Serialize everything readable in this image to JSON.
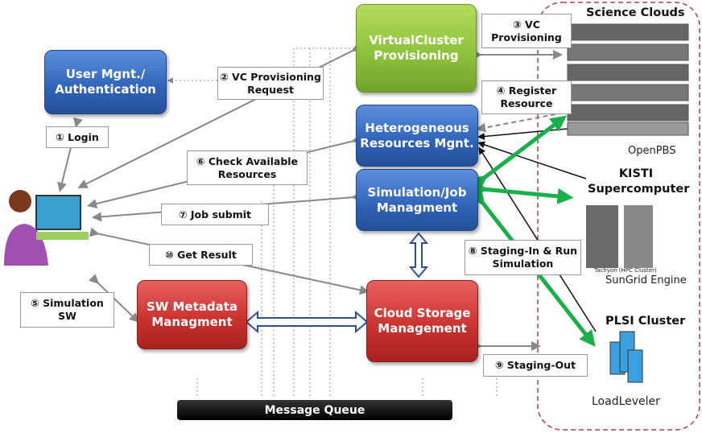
{
  "boxes": {
    "user_mgnt": "User Mgnt./ Authentication",
    "virtual_cluster": "VirtualCluster Provisioning",
    "heterogeneous": "Heterogeneous Resources Mgnt.",
    "simulation_job": "Simulation/Job Managment",
    "sw_metadata": "SW Metadata Managment",
    "cloud_storage": "Cloud Storage Management",
    "message_queue": "Message Queue"
  },
  "steps": {
    "s1": "① Login",
    "s2": "② VC Provisioning Request",
    "s3": "③ VC Provisioning",
    "s4": "④ Register Resource",
    "s5": "⑤ Simulation SW",
    "s6": "⑥ Check Available Resources",
    "s7": "⑦ Job submit",
    "s8": "⑧ Staging-In & Run Simulation",
    "s9": "⑨ Staging-Out",
    "s10": "⑩ Get Result"
  },
  "resources": {
    "region_title": "Science Clouds",
    "openpbs": "OpenPBS",
    "kisti": "KISTI Supercomputer",
    "tachyon": "Tachyon (HPC Cluster)",
    "sungrid": "SunGrid Engine",
    "plsi": "PLSI Cluster",
    "loadleveler": "LoadLeveler"
  },
  "colors": {
    "blue": "#2f63b8",
    "green": "#8cc03a",
    "red": "#c8302c",
    "arrow_green": "#19b04a",
    "region_border": "#b04040"
  }
}
